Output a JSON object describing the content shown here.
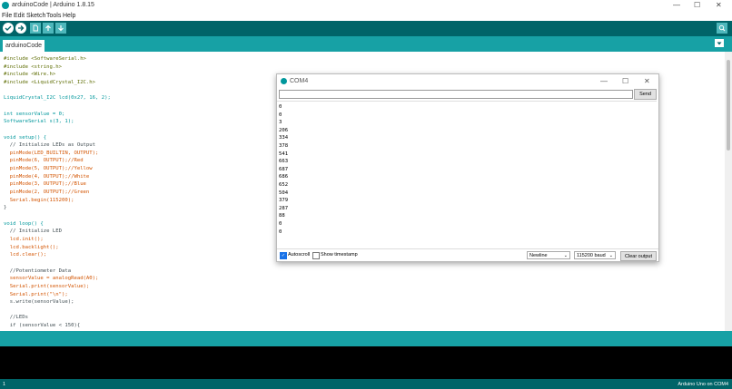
{
  "window": {
    "title": "arduinoCode | Arduino 1.8.15",
    "minimize": "—",
    "maximize": "☐",
    "close": "✕"
  },
  "menu": [
    "File",
    "Edit",
    "Sketch",
    "Tools",
    "Help"
  ],
  "toolbar": {
    "verify_icon": "check-icon",
    "upload_icon": "arrow-right-icon",
    "new_icon": "new-file-icon",
    "open_icon": "arrow-up-icon",
    "save_icon": "arrow-down-icon",
    "serial_icon": "magnifier-icon",
    "tab_menu_icon": "chevron-down-icon"
  },
  "tab": {
    "label": "arduinoCode"
  },
  "code": [
    "#include <SoftwareSerial.h>",
    "#include <string.h>",
    "#include <Wire.h>",
    "#include <LiquidCrystal_I2C.h>",
    "",
    "LiquidCrystal_I2C lcd(0x27, 16, 2);",
    "",
    "int sensorValue = 0;",
    "SoftwareSerial s(3, 1);",
    "",
    "void setup() {",
    "  // Initialize LEDs as Output",
    "  pinMode(LED_BUILTIN, OUTPUT);",
    "  pinMode(6, OUTPUT);//Red",
    "  pinMode(5, OUTPUT);//Yellow",
    "  pinMode(4, OUTPUT);//White",
    "  pinMode(3, OUTPUT);//Blue",
    "  pinMode(2, OUTPUT);//Green",
    "  Serial.begin(115200);",
    "}",
    "",
    "void loop() {",
    "  // Initialize LED",
    "  lcd.init();",
    "  lcd.backlight();",
    "  lcd.clear();",
    "",
    "  //Potentiometer Data",
    "  sensorValue = analogRead(A0);",
    "  Serial.print(sensorValue);",
    "  Serial.print(\"\\n\");",
    "  s.write(sensorValue);",
    "",
    "  //LEDs",
    "  if (sensorValue < 150){"
  ],
  "serial_monitor": {
    "title": "COM4",
    "send_label": "Send",
    "output": [
      "0",
      "0",
      "3",
      "206",
      "334",
      "378",
      "541",
      "663",
      "687",
      "686",
      "652",
      "504",
      "379",
      "287",
      "88",
      "0",
      "0"
    ],
    "autoscroll_label": "Autoscroll",
    "autoscroll_checked": true,
    "timestamp_label": "Show timestamp",
    "timestamp_checked": false,
    "line_ending": "Newline",
    "baud": "115200 baud",
    "clear_label": "Clear output"
  },
  "status": {
    "line": "1",
    "board": "Arduino Uno on COM4"
  }
}
